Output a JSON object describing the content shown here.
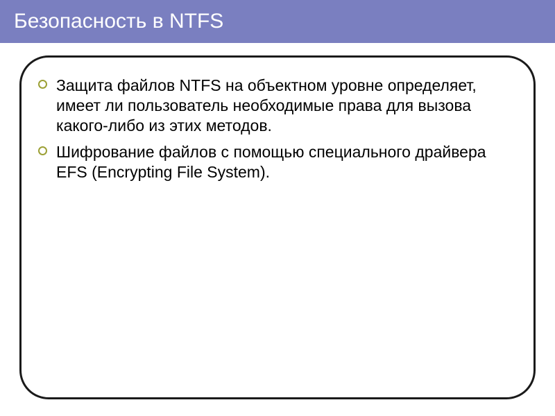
{
  "slide": {
    "title": "Безопасность в NTFS",
    "bullets": [
      "Защита файлов NTFS на объектном уровне определяет, имеет ли пользователь необходимые права для вызова какого-либо из этих методов.",
      "Шифрование файлов с помощью специального драйвера EFS (Encrypting File System)."
    ]
  }
}
